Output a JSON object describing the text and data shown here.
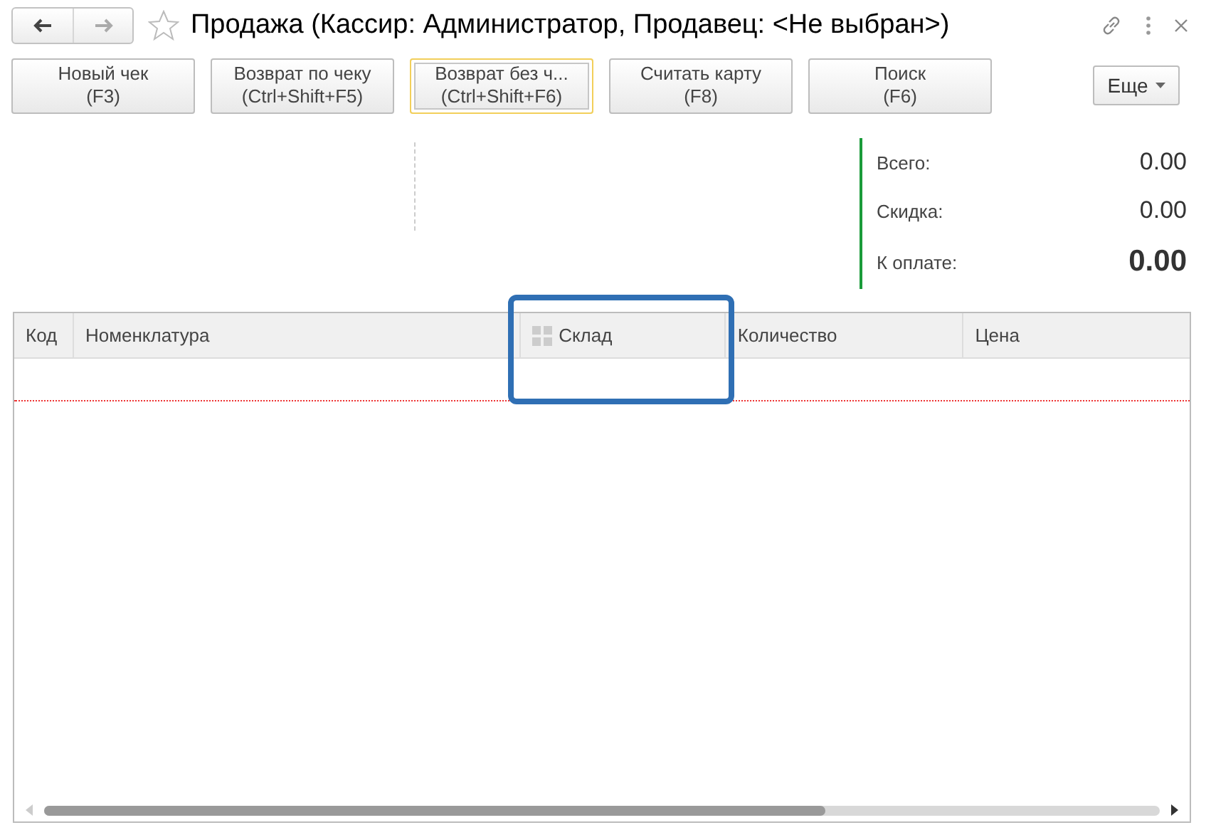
{
  "window": {
    "title": "Продажа (Кассир: Администратор, Продавец: <Не выбран>)"
  },
  "toolbar": {
    "buttons": [
      {
        "label": "Новый чек",
        "shortcut": "(F3)",
        "focused": false
      },
      {
        "label": "Возврат по чеку",
        "shortcut": "(Ctrl+Shift+F5)",
        "focused": false
      },
      {
        "label": "Возврат без ч...",
        "shortcut": "(Ctrl+Shift+F6)",
        "focused": true
      },
      {
        "label": "Считать карту",
        "shortcut": "(F8)",
        "focused": false
      },
      {
        "label": "Поиск",
        "shortcut": "(F6)",
        "focused": false
      }
    ],
    "more": "Еще"
  },
  "totals": [
    {
      "label": "Всего:",
      "value": "0.00",
      "kind": "normal"
    },
    {
      "label": "Скидка:",
      "value": "0.00",
      "kind": "normal"
    },
    {
      "label": "К оплате:",
      "value": "0.00",
      "kind": "total"
    }
  ],
  "table": {
    "columns": [
      {
        "label": "Код",
        "kind": "text",
        "highlighted": false
      },
      {
        "label": "Номенклатура",
        "kind": "text",
        "highlighted": false
      },
      {
        "label": "Склад",
        "kind": "icon",
        "highlighted": true
      },
      {
        "label": "Количество",
        "kind": "text",
        "highlighted": false
      },
      {
        "label": "Цена",
        "kind": "text",
        "highlighted": false
      }
    ]
  }
}
